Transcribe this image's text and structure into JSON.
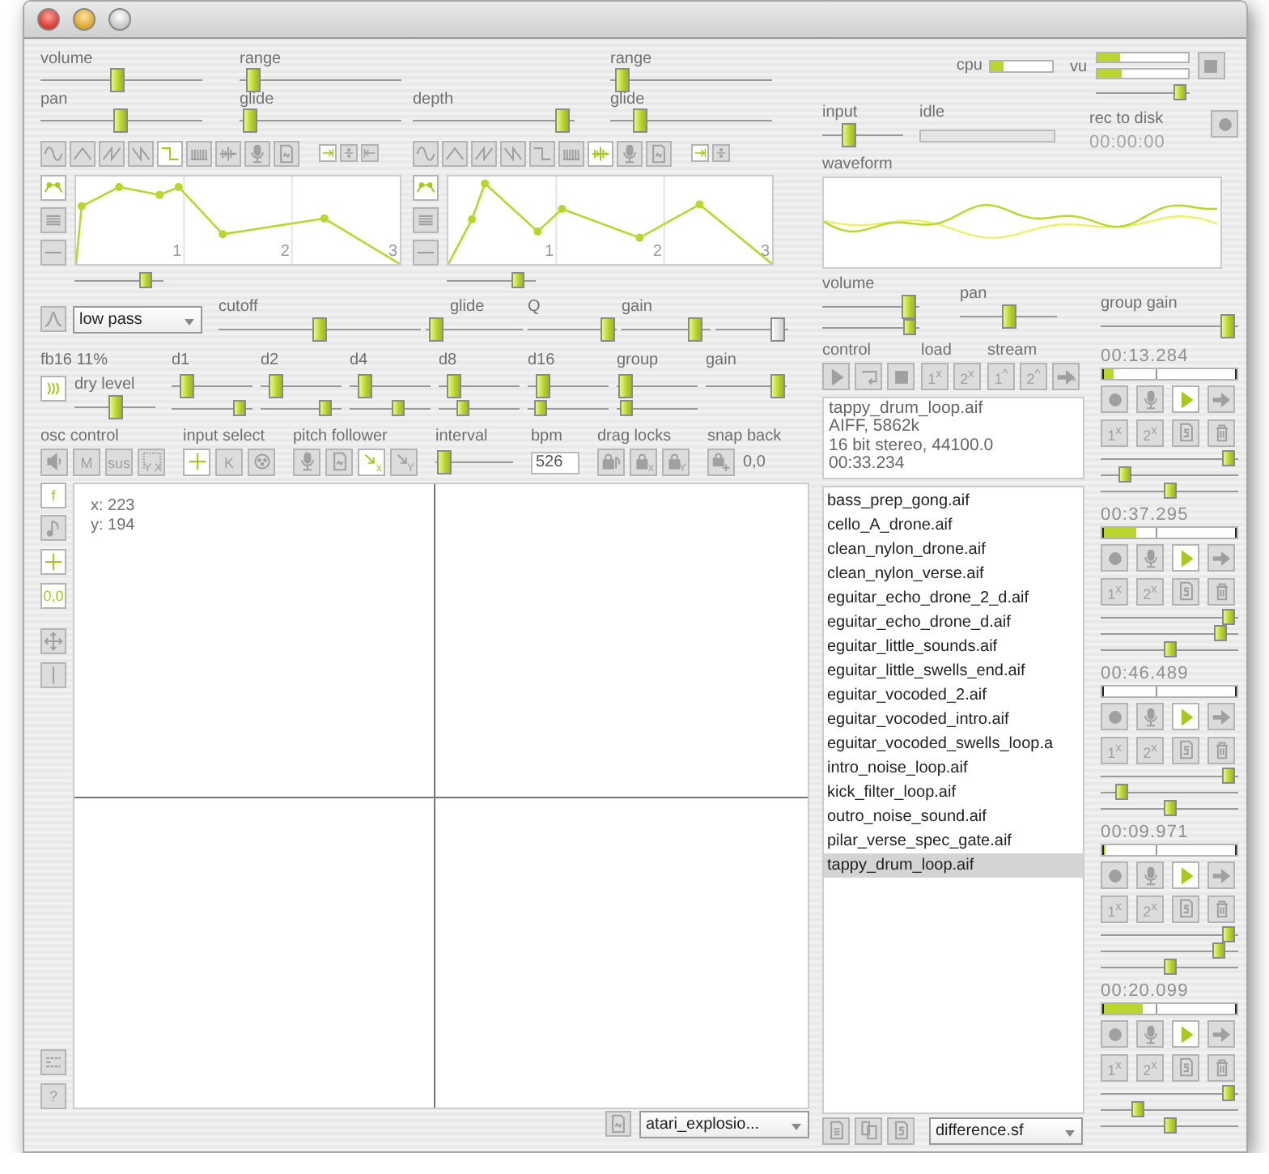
{
  "slider_columns": [
    [
      {
        "label": "volume",
        "level": 0.47
      },
      {
        "label": "pan",
        "level": 0.49
      }
    ],
    [
      {
        "label": "range",
        "level": 0.04
      },
      {
        "label": "glide",
        "level": 0.02
      }
    ],
    [
      {
        "label": "depth",
        "level": 0.97
      }
    ],
    [
      {
        "label": "range",
        "level": 0.03
      },
      {
        "label": "glide",
        "level": 0.15
      }
    ]
  ],
  "lfos": [
    {
      "waves": [
        {
          "kind": "sine",
          "selected": false
        },
        {
          "kind": "triangle",
          "selected": false
        },
        {
          "kind": "saw",
          "selected": false
        },
        {
          "kind": "ramp",
          "selected": false
        },
        {
          "kind": "square",
          "selected": true
        },
        {
          "kind": "comb",
          "selected": false
        },
        {
          "kind": "noise",
          "selected": false
        },
        {
          "kind": "mic",
          "selected": false
        },
        {
          "kind": "file",
          "selected": false
        }
      ],
      "modes": [
        {
          "kind": "arrow-right",
          "selected": true
        },
        {
          "kind": "divide",
          "selected": false
        },
        {
          "kind": "arrow-left",
          "selected": false
        }
      ],
      "shapes": [
        {
          "kind": "envelope",
          "selected": true
        },
        {
          "kind": "lines",
          "selected": false
        },
        {
          "kind": "flat",
          "selected": false
        }
      ],
      "ticks": [
        "1",
        "2",
        "3"
      ],
      "level": 0.85
    },
    {
      "waves": [
        {
          "kind": "sine",
          "selected": false
        },
        {
          "kind": "triangle",
          "selected": false
        },
        {
          "kind": "saw",
          "selected": false
        },
        {
          "kind": "ramp",
          "selected": false
        },
        {
          "kind": "square",
          "selected": false
        },
        {
          "kind": "comb",
          "selected": false
        },
        {
          "kind": "noise",
          "selected": true
        },
        {
          "kind": "mic",
          "selected": false
        },
        {
          "kind": "file",
          "selected": false
        }
      ],
      "modes": [
        {
          "kind": "arrow-right",
          "selected": true
        },
        {
          "kind": "divide",
          "selected": false
        }
      ],
      "shapes": [
        {
          "kind": "envelope",
          "selected": true
        },
        {
          "kind": "lines",
          "selected": false
        },
        {
          "kind": "flat",
          "selected": false
        }
      ],
      "ticks": [
        "1",
        "2",
        "3"
      ],
      "level": 0.85
    }
  ],
  "filter": {
    "button": {
      "kind": "filter",
      "selected": false
    },
    "type": "low pass",
    "sliders": [
      {
        "label": "cutoff",
        "level": 0.5,
        "disabled": false
      },
      {
        "label": "glide",
        "level": 0.03,
        "disabled": false
      },
      {
        "label": "Q",
        "level": 0.97,
        "disabled": false
      },
      {
        "label": "gain",
        "level": 0.9,
        "disabled": false
      },
      {
        "level": 0.95,
        "disabled": true
      }
    ]
  },
  "delay": {
    "readout": "fb16 11%",
    "button": {
      "kind": "waves",
      "selected": true
    },
    "dry": {
      "label": "dry level",
      "level": 0.5
    },
    "taps": [
      {
        "label": "d1",
        "sliders": [
          {
            "level": 0.12
          },
          {
            "level": 0.9
          }
        ]
      },
      {
        "label": "d2",
        "sliders": [
          {
            "level": 0.12
          },
          {
            "level": 0.85
          }
        ]
      },
      {
        "label": "d4",
        "sliders": [
          {
            "level": 0.12
          },
          {
            "level": 0.62
          }
        ]
      },
      {
        "label": "d8",
        "sliders": [
          {
            "level": 0.12
          },
          {
            "level": 0.25
          }
        ]
      },
      {
        "label": "d16",
        "sliders": [
          {
            "level": 0.12
          },
          {
            "level": 0.1
          }
        ]
      },
      {
        "label": "group",
        "sliders": [
          {
            "level": 0.02
          },
          {
            "level": 0.04
          }
        ]
      },
      {
        "label": "gain",
        "sliders": [
          {
            "level": 0.97
          }
        ]
      }
    ]
  },
  "controls": [
    {
      "kind": "buttons",
      "label": "osc control",
      "buttons": [
        {
          "kind": "speaker",
          "selected": false
        },
        {
          "text": "M",
          "selected": false
        },
        {
          "text": "sus",
          "selected": false
        },
        {
          "kind": "corner",
          "text": "Y X",
          "selected": false
        }
      ]
    },
    {
      "kind": "buttons",
      "label": "input select",
      "buttons": [
        {
          "kind": "crosshair",
          "selected": true
        },
        {
          "text": "K",
          "selected": false
        },
        {
          "kind": "dial",
          "selected": false
        }
      ]
    },
    {
      "kind": "buttons",
      "label": "pitch follower",
      "buttons": [
        {
          "kind": "mic",
          "selected": false
        },
        {
          "kind": "file",
          "selected": false
        },
        {
          "kind": "diagonal-arrow",
          "text": "x",
          "selected": true
        },
        {
          "kind": "diagonal-arrow",
          "text": "Y",
          "selected": false
        }
      ]
    },
    {
      "kind": "slider",
      "label": "interval",
      "level": 0.03
    },
    {
      "kind": "field",
      "label": "bpm",
      "value": "526"
    },
    {
      "kind": "buttons",
      "label": "drag locks",
      "buttons": [
        {
          "kind": "lock-note",
          "selected": false
        },
        {
          "kind": "lock",
          "text": "x",
          "selected": false
        },
        {
          "kind": "lock",
          "text": "Y",
          "selected": false
        }
      ]
    },
    {
      "kind": "buttons",
      "label": "snap back",
      "buttons": [
        {
          "kind": "lock-plus",
          "selected": false
        }
      ],
      "readout": "0,0"
    }
  ],
  "pad": {
    "tools": [
      {
        "text": "f",
        "selected": true
      },
      {
        "kind": "note",
        "selected": false
      },
      {
        "kind": "crosshair",
        "selected": true
      },
      {
        "text": "0,0",
        "selected": true
      },
      {
        "kind": "move",
        "selected": false
      },
      {
        "kind": "bar",
        "selected": false
      }
    ],
    "bottom_tools": [
      {
        "kind": "dashed",
        "selected": false
      },
      {
        "text": "?",
        "selected": false
      }
    ],
    "x": "x: 223",
    "y": "y: 194",
    "file_button": {
      "kind": "file"
    },
    "preset": "atari_explosio..."
  },
  "cpu": {
    "label": "cpu",
    "level": 0.22
  },
  "vu": {
    "label": "vu",
    "meters": [
      {
        "level": 0.25
      },
      {
        "level": 0.27
      }
    ],
    "stop_button": {
      "kind": "stop"
    },
    "level": 0.97
  },
  "input": {
    "label": "input",
    "level": 0.3
  },
  "idle": {
    "label": "idle"
  },
  "recorder": {
    "label": "rec to disk",
    "time": "00:00:00",
    "button": {
      "kind": "record"
    }
  },
  "waveform": {
    "label": "waveform"
  },
  "player": {
    "volume": {
      "label": "volume",
      "sliders": [
        {
          "level": 0.97
        },
        {
          "level": 0.97
        }
      ]
    },
    "pan": {
      "label": "pan",
      "level": 0.5
    },
    "groups": [
      {
        "label": "control",
        "buttons": [
          {
            "kind": "play"
          },
          {
            "kind": "loop"
          },
          {
            "kind": "stop"
          }
        ]
      },
      {
        "label": "load",
        "buttons": [
          {
            "text": "1$^{x}$"
          },
          {
            "text": "2$^{x}$"
          }
        ]
      },
      {
        "label": "stream",
        "buttons": [
          {
            "text": "1$^{^}$"
          },
          {
            "text": "2$^{^}$"
          },
          {
            "kind": "arrow",
            "text": "*"
          }
        ]
      }
    ],
    "info": [
      "tappy_drum_loop.aif",
      "AIFF, 5862k",
      "16 bit stereo, 44100.0",
      "00:33.234"
    ],
    "files": [
      {
        "name": "bass_prep_gong.aif",
        "selected": false
      },
      {
        "name": "cello_A_drone.aif",
        "selected": false
      },
      {
        "name": "clean_nylon_drone.aif",
        "selected": false
      },
      {
        "name": "clean_nylon_verse.aif",
        "selected": false
      },
      {
        "name": "eguitar_echo_drone_2_d.aif",
        "selected": false
      },
      {
        "name": "eguitar_echo_drone_d.aif",
        "selected": false
      },
      {
        "name": "eguitar_little_sounds.aif",
        "selected": false
      },
      {
        "name": "eguitar_little_swells_end.aif",
        "selected": false
      },
      {
        "name": "eguitar_vocoded_2.aif",
        "selected": false
      },
      {
        "name": "eguitar_vocoded_intro.aif",
        "selected": false
      },
      {
        "name": "eguitar_vocoded_swells_loop.a",
        "selected": false
      },
      {
        "name": "intro_noise_loop.aif",
        "selected": false
      },
      {
        "name": "kick_filter_loop.aif",
        "selected": false
      },
      {
        "name": "outro_noise_sound.aif",
        "selected": false
      },
      {
        "name": "pilar_verse_spec_gate.aif",
        "selected": false
      },
      {
        "name": "tappy_drum_loop.aif",
        "selected": true
      }
    ],
    "file_tools": [
      {
        "kind": "doc-lines"
      },
      {
        "kind": "doc-copy"
      },
      {
        "kind": "doc-s"
      }
    ],
    "preset": "difference.sf"
  },
  "group_gain": {
    "label": "group gain",
    "level": 0.98
  },
  "strips": [
    {
      "time": "00:13.284",
      "level": 0.08,
      "buttons": [
        {
          "kind": "record",
          "selected": false
        },
        {
          "kind": "mic",
          "selected": false
        },
        {
          "kind": "play",
          "selected": true
        },
        {
          "kind": "arrow",
          "selected": false
        }
      ],
      "tools": [
        {
          "text": "1$^{x}$"
        },
        {
          "text": "2$^{x}$"
        },
        {
          "kind": "doc-s"
        },
        {
          "kind": "trash"
        }
      ],
      "sliders": [
        {
          "level": 0.98
        },
        {
          "level": 0.14
        },
        {
          "level": 0.5
        }
      ]
    },
    {
      "time": "00:37.295",
      "level": 0.25,
      "buttons": [
        {
          "kind": "record",
          "selected": false
        },
        {
          "kind": "mic",
          "selected": false
        },
        {
          "kind": "play",
          "selected": true
        },
        {
          "kind": "arrow",
          "selected": false
        }
      ],
      "tools": [
        {
          "text": "1$^{x}$"
        },
        {
          "text": "2$^{x}$"
        },
        {
          "kind": "doc-s"
        },
        {
          "kind": "trash"
        }
      ],
      "sliders": [
        {
          "level": 0.98
        },
        {
          "level": 0.91
        },
        {
          "level": 0.5
        }
      ]
    },
    {
      "time": "00:46.489",
      "level": 0.0,
      "buttons": [
        {
          "kind": "record",
          "selected": false
        },
        {
          "kind": "mic",
          "selected": false
        },
        {
          "kind": "play",
          "selected": true
        },
        {
          "kind": "arrow",
          "selected": false
        }
      ],
      "tools": [
        {
          "text": "1$^{x}$"
        },
        {
          "text": "2$^{x}$"
        },
        {
          "kind": "doc-s"
        },
        {
          "kind": "trash"
        }
      ],
      "sliders": [
        {
          "level": 0.98
        },
        {
          "level": 0.12
        },
        {
          "level": 0.5
        }
      ]
    },
    {
      "time": "00:09.971",
      "level": 0.02,
      "buttons": [
        {
          "kind": "record",
          "selected": false
        },
        {
          "kind": "mic",
          "selected": false
        },
        {
          "kind": "play",
          "selected": true
        },
        {
          "kind": "arrow",
          "selected": false
        }
      ],
      "tools": [
        {
          "text": "1$^{x}$"
        },
        {
          "text": "2$^{x}$"
        },
        {
          "kind": "doc-s"
        },
        {
          "kind": "trash"
        }
      ],
      "sliders": [
        {
          "level": 0.98
        },
        {
          "level": 0.9
        },
        {
          "level": 0.5
        }
      ]
    },
    {
      "time": "00:20.099",
      "level": 0.3,
      "buttons": [
        {
          "kind": "record",
          "selected": false
        },
        {
          "kind": "mic",
          "selected": false
        },
        {
          "kind": "play",
          "selected": true
        },
        {
          "kind": "arrow",
          "selected": false
        }
      ],
      "tools": [
        {
          "text": "1$^{x}$"
        },
        {
          "text": "2$^{x}$"
        },
        {
          "kind": "doc-s"
        },
        {
          "kind": "trash"
        }
      ],
      "sliders": [
        {
          "level": 0.98
        },
        {
          "level": 0.25
        },
        {
          "level": 0.5
        }
      ]
    }
  ]
}
